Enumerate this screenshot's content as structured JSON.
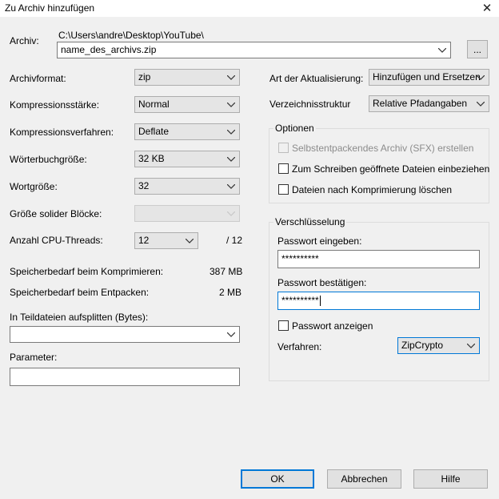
{
  "window": {
    "title": "Zu Archiv hinzufügen",
    "close_glyph": "✕"
  },
  "archive": {
    "label": "Archiv:",
    "path": "C:\\Users\\andre\\Desktop\\YouTube\\",
    "filename": "name_des_archivs.zip",
    "browse_label": "..."
  },
  "left": {
    "format_label": "Archivformat:",
    "format_value": "zip",
    "level_label": "Kompressionsstärke:",
    "level_value": "Normal",
    "method_label": "Kompressionsverfahren:",
    "method_value": "Deflate",
    "dict_label": "Wörterbuchgröße:",
    "dict_value": "32 KB",
    "word_label": "Wortgröße:",
    "word_value": "32",
    "solid_label": "Größe solider Blöcke:",
    "solid_value": "",
    "threads_label": "Anzahl CPU-Threads:",
    "threads_value": "12",
    "threads_total": "/ 12",
    "mem_comp_label": "Speicherbedarf beim Komprimieren:",
    "mem_comp_value": "387 MB",
    "mem_decomp_label": "Speicherbedarf beim Entpacken:",
    "mem_decomp_value": "2 MB",
    "split_label": "In Teildateien aufsplitten (Bytes):",
    "split_value": "",
    "params_label": "Parameter:",
    "params_value": ""
  },
  "right": {
    "update_label": "Art der Aktualisierung:",
    "update_value": "Hinzufügen und Ersetzen",
    "paths_label": "Verzeichnisstruktur",
    "paths_value": "Relative Pfadangaben",
    "options": {
      "title": "Optionen",
      "sfx_label": "Selbstentpackendes Archiv (SFX) erstellen",
      "shared_label": "Zum Schreiben geöffnete Dateien einbeziehen",
      "delete_label": "Dateien nach Komprimierung löschen"
    },
    "encryption": {
      "title": "Verschlüsselung",
      "pw_label": "Passwort eingeben:",
      "pw_value": "**********",
      "pw2_label": "Passwort bestätigen:",
      "pw2_value": "**********",
      "show_label": "Passwort anzeigen",
      "method_label": "Verfahren:",
      "method_value": "ZipCrypto"
    }
  },
  "buttons": {
    "ok": "OK",
    "cancel": "Abbrechen",
    "help": "Hilfe"
  }
}
